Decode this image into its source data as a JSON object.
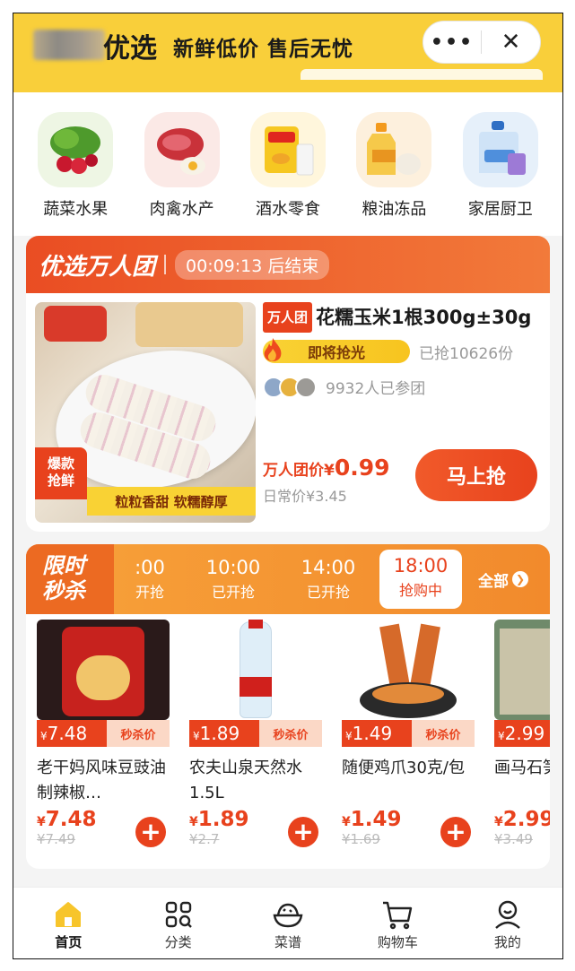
{
  "header": {
    "brand": "优选",
    "slogan": "新鲜低价 售后无忧",
    "more_label": "•••",
    "close_label": "✕"
  },
  "categories": [
    {
      "label": "蔬菜水果",
      "icon": "vegetables-icon"
    },
    {
      "label": "肉禽水产",
      "icon": "meat-icon"
    },
    {
      "label": "酒水零食",
      "icon": "snacks-icon"
    },
    {
      "label": "粮油冻品",
      "icon": "oil-icon"
    },
    {
      "label": "家居厨卫",
      "icon": "detergent-icon"
    }
  ],
  "group_deal": {
    "title": "优选万人团",
    "timer": "00:09:13 后结束",
    "image_tags": {
      "hot": "爆款\n抢鲜",
      "slogan": "粒粒香甜 软糯醇厚"
    },
    "badge": "万人团",
    "product_name": "花糯玉米1根300g±30g",
    "progress_label": "即将抢光",
    "sold": "已抢10626份",
    "joined": "9932人已参团",
    "price_label": "万人团价¥",
    "price": "0.99",
    "daily_price": "日常价¥3.45",
    "buy_label": "马上抢"
  },
  "flash_sale": {
    "title_line1": "限时",
    "title_line2": "秒杀",
    "slots": [
      {
        "time": ":00",
        "status": "开抢"
      },
      {
        "time": "10:00",
        "status": "已开抢"
      },
      {
        "time": "14:00",
        "status": "已开抢"
      },
      {
        "time": "18:00",
        "status": "抢购中"
      }
    ],
    "all_label": "全部",
    "tag_label": "秒杀价",
    "items": [
      {
        "name": "老干妈风味豆豉油制辣椒…",
        "tag_price": "7.48",
        "price": "7.48",
        "old": "¥7.49"
      },
      {
        "name": "农夫山泉天然水1.5L",
        "tag_price": "1.89",
        "price": "1.89",
        "old": "¥2.7"
      },
      {
        "name": "随便鸡爪30克/包",
        "tag_price": "1.49",
        "price": "1.49",
        "old": "¥1.69"
      },
      {
        "name": "画马石笋瓶装",
        "tag_price": "2.99",
        "price": "2.99",
        "old": "¥3.49"
      }
    ]
  },
  "tabbar": [
    {
      "label": "首页",
      "icon": "home-icon"
    },
    {
      "label": "分类",
      "icon": "category-icon"
    },
    {
      "label": "菜谱",
      "icon": "recipe-icon"
    },
    {
      "label": "购物车",
      "icon": "cart-icon"
    },
    {
      "label": "我的",
      "icon": "profile-icon"
    }
  ],
  "colors": {
    "primary": "#e8421d",
    "header": "#f9cf3a",
    "flash": "#f28a2c"
  }
}
